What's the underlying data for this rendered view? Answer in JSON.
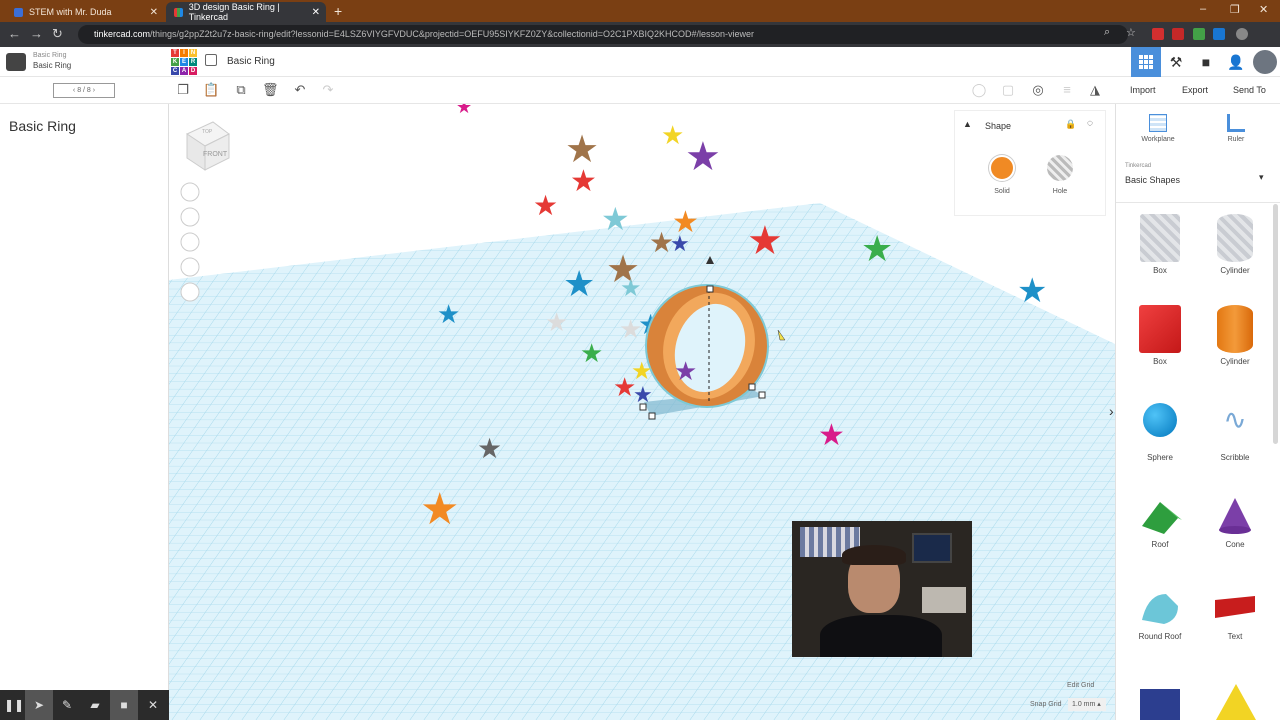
{
  "browser": {
    "tabs": [
      {
        "title": "STEM with Mr. Duda",
        "active": false
      },
      {
        "title": "3D design Basic Ring | Tinkercad",
        "active": true
      }
    ],
    "url_host": "tinkercad.com",
    "url_path": "/things/g2ppZ2t2u7z-basic-ring/edit?lessonid=E4LSZ6VIYGFVDUC&projectid=OEFU95SIYKFZ0ZY&collectionid=O2C1PXBIQ2KHCOD#/lesson-viewer"
  },
  "header": {
    "lesson_small": "Basic Ring",
    "lesson_name": "Basic Ring",
    "design_name": "Basic Ring",
    "logo_letters": [
      "T",
      "I",
      "N",
      "K",
      "E",
      "R",
      "C",
      "A",
      "D"
    ]
  },
  "toolbar": {
    "pager": "8 / 8",
    "import_label": "Import",
    "export_label": "Export",
    "sendto_label": "Send To"
  },
  "left_panel": {
    "title": "Basic Ring"
  },
  "viewcube": {
    "top_label": "TOP",
    "front_label": "FRONT"
  },
  "shape_panel": {
    "title": "Shape",
    "solid_label": "Solid",
    "hole_label": "Hole",
    "solid_color": "#f08a24"
  },
  "right_panel": {
    "workplane_label": "Workplane",
    "ruler_label": "Ruler",
    "category_small": "Tinkercad",
    "category": "Basic Shapes",
    "shapes": [
      {
        "label": "Box",
        "icon": "box-hole-icon"
      },
      {
        "label": "Cylinder",
        "icon": "cylinder-hole-icon"
      },
      {
        "label": "Box",
        "icon": "box-icon"
      },
      {
        "label": "Cylinder",
        "icon": "cylinder-icon"
      },
      {
        "label": "Sphere",
        "icon": "sphere-icon"
      },
      {
        "label": "Scribble",
        "icon": "scribble-icon"
      },
      {
        "label": "Roof",
        "icon": "roof-icon"
      },
      {
        "label": "Cone",
        "icon": "cone-icon"
      },
      {
        "label": "Round Roof",
        "icon": "round-roof-icon"
      },
      {
        "label": "Text",
        "icon": "text-icon"
      }
    ]
  },
  "grid": {
    "edit_grid_label": "Edit Grid",
    "snap_grid_label": "Snap Grid",
    "snap_grid_value": "1.0 mm"
  },
  "colors": {
    "grid_blue": "#9fd6ea",
    "ring_orange": "#d9833a",
    "tab_bar": "#7a3f13"
  }
}
